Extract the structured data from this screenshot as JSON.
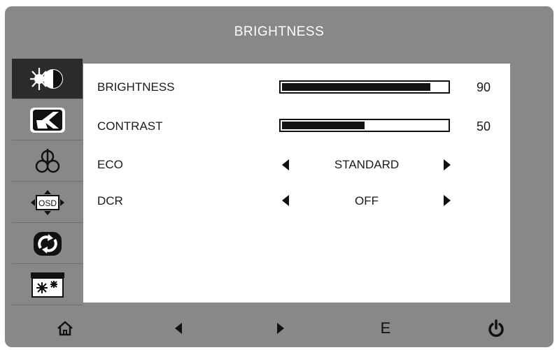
{
  "title": "BRIGHTNESS",
  "sidebar": {
    "items": [
      {
        "icon": "luminance-icon",
        "active": true
      },
      {
        "icon": "image-setup-icon",
        "active": false
      },
      {
        "icon": "color-temp-icon",
        "active": false
      },
      {
        "icon": "osd-setup-icon",
        "osd_text": "OSD",
        "active": false
      },
      {
        "icon": "reset-icon",
        "active": false
      },
      {
        "icon": "extra-icon",
        "active": false
      }
    ]
  },
  "settings": {
    "brightness": {
      "label": "BRIGHTNESS",
      "value": "90",
      "level": 0.9
    },
    "contrast": {
      "label": "CONTRAST",
      "value": "50",
      "level": 0.5
    },
    "eco": {
      "label": "ECO",
      "value": "STANDARD"
    },
    "dcr": {
      "label": "DCR",
      "value": "OFF"
    }
  },
  "buttons": {
    "home": {
      "icon": "home-icon"
    },
    "left": {
      "icon": "left-arrow-icon"
    },
    "right": {
      "icon": "right-arrow-icon"
    },
    "enter": {
      "label": "E"
    },
    "power": {
      "icon": "power-icon"
    }
  },
  "colors": {
    "osd_gray": "#888888",
    "active_bg": "#2b2b2b",
    "panel": "#ffffff",
    "ink": "#111111"
  }
}
